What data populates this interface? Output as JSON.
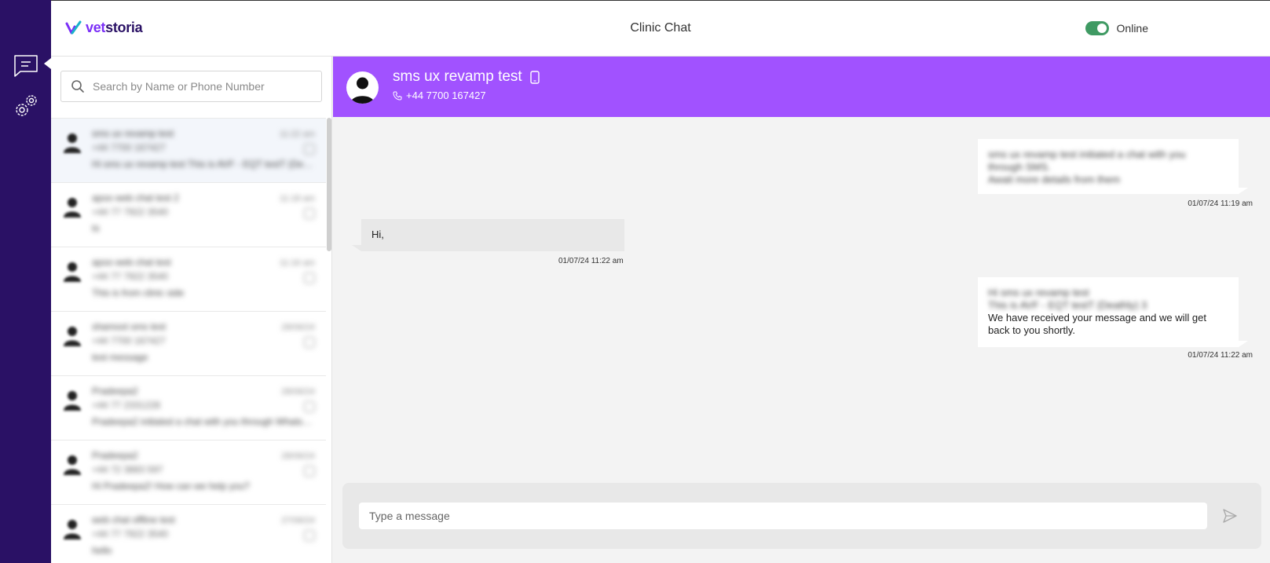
{
  "app": {
    "brand_part1": "vet",
    "brand_part2": "storia",
    "title": "Clinic Chat"
  },
  "status": {
    "label": "Online",
    "toggle_on": true,
    "toggle_color": "#3f9a63"
  },
  "colors": {
    "rail": "#2a1165",
    "header": "#a152ff",
    "brand_purple": "#7b2ff7"
  },
  "rail": {
    "items": [
      {
        "icon": "chat-icon"
      },
      {
        "icon": "gears-icon"
      }
    ]
  },
  "search": {
    "placeholder": "Search by Name or Phone Number",
    "value": ""
  },
  "conversations": [
    {
      "name": "sms ux revamp test",
      "phone": "+44 7700 167427",
      "time": "11:22 am",
      "preview": "Hi sms ux revamp test This is AVF - EQT testT (Deathly..."
    },
    {
      "name": "apoo web chat test 2",
      "phone": "+44 77 7922 3540",
      "time": "11:18 am",
      "preview": "hi"
    },
    {
      "name": "apoo web chat test",
      "phone": "+44 77 7922 3540",
      "time": "11:16 am",
      "preview": "This is from clinic side"
    },
    {
      "name": "shamoot sms test",
      "phone": "+44 7700 167427",
      "time": "28/06/24",
      "preview": "test message"
    },
    {
      "name": "Pradeepa2",
      "phone": "+44 77 2331228",
      "time": "28/06/24",
      "preview": "Pradeepa2 initiated a chat with you through WhatsA..."
    },
    {
      "name": "Pradeepa2",
      "phone": "+44 72 3883 597",
      "time": "28/06/24",
      "preview": "Hi Pradeepa2! How can we help you?"
    },
    {
      "name": "web chat offline test",
      "phone": "+44 77 7922 3540",
      "time": "27/06/24",
      "preview": "hello"
    }
  ],
  "chat": {
    "contact_name": "sms ux revamp test",
    "contact_phone": "+44 7700 167427",
    "messages": [
      {
        "direction": "out",
        "lines": [
          "sms ux revamp test initiated a chat with you",
          "through SMS.",
          "Await more details from them"
        ],
        "time": "01/07/24 11:19 am"
      },
      {
        "direction": "in",
        "text": "Hi,",
        "time": "01/07/24 11:22 am"
      },
      {
        "direction": "out",
        "blurred": [
          "Hi sms ux revamp test",
          "This is AVF - EQT testT (Deathly) 3"
        ],
        "text": "We have received your message and we will get back to you shortly.",
        "time": "01/07/24 11:22 am"
      }
    ]
  },
  "composer": {
    "placeholder": "Type a message",
    "value": ""
  }
}
